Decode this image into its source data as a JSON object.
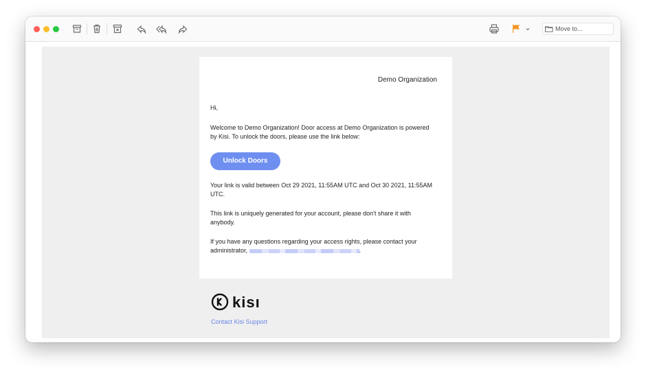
{
  "toolbar": {
    "icons": [
      "archive-icon",
      "trash-icon",
      "junk-icon",
      "reply-icon",
      "reply-all-icon",
      "forward-icon",
      "print-icon",
      "flag-icon",
      "chevron-down-icon",
      "folder-icon"
    ],
    "move_to_placeholder": "Move to...",
    "flag_color": "#f29624"
  },
  "email": {
    "organization": "Demo Organization",
    "greeting": "Hi,",
    "welcome": "Welcome to Demo Organization! Door access at Demo Organization is powered by Kisi. To unlock the doors, please use the link below:",
    "button_label": "Unlock Doors",
    "button_color": "#6f8ff0",
    "validity": "Your link is valid between Oct 29 2021, 11:55AM UTC and Oct 30 2021, 11:55AM UTC.",
    "uniqueness": "This link is uniquely generated for your account, please don't share it with anybody.",
    "contact_prefix": "If you have any questions regarding your access rights, please contact your administrator,",
    "contact_suffix": "."
  },
  "footer": {
    "brand": "kisı",
    "support_link": "Contact Kisi Support",
    "link_color": "#6a86e8"
  }
}
